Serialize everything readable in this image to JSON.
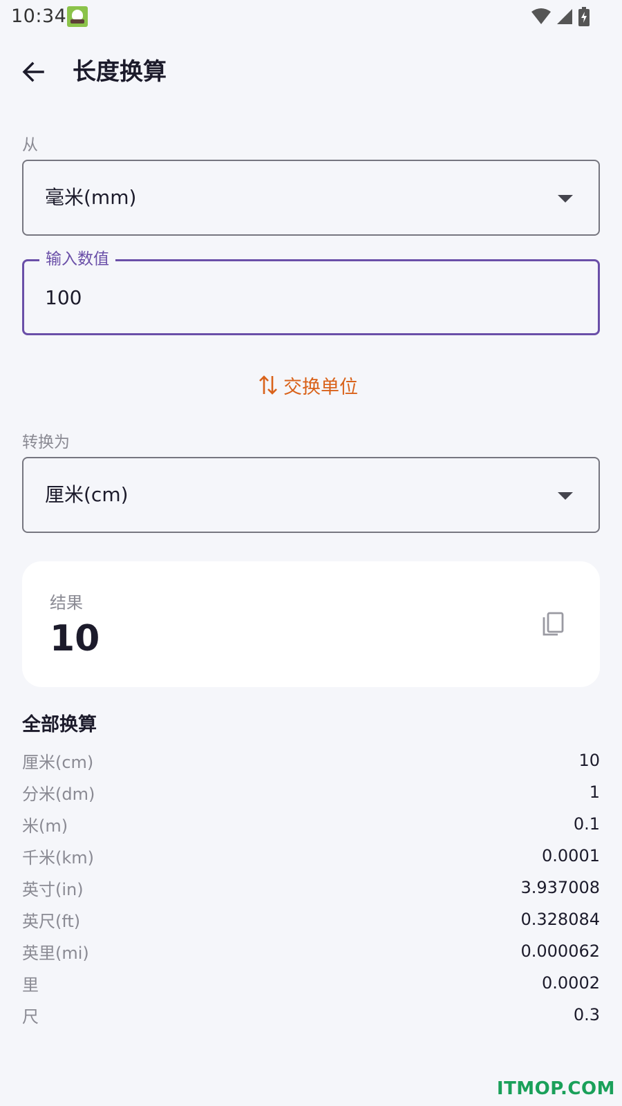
{
  "status_bar": {
    "time": "10:34"
  },
  "header": {
    "title": "长度换算"
  },
  "from": {
    "label": "从",
    "selected": "毫米(mm)"
  },
  "input": {
    "label": "输入数值",
    "value": "100"
  },
  "swap": {
    "label": "交换单位"
  },
  "to": {
    "label": "转换为",
    "selected": "厘米(cm)"
  },
  "result": {
    "label": "结果",
    "value": "10"
  },
  "all_conversions": {
    "title": "全部换算",
    "rows": [
      {
        "unit": "厘米(cm)",
        "value": "10"
      },
      {
        "unit": "分米(dm)",
        "value": "1"
      },
      {
        "unit": "米(m)",
        "value": "0.1"
      },
      {
        "unit": "千米(km)",
        "value": "0.0001"
      },
      {
        "unit": "英寸(in)",
        "value": "3.937008"
      },
      {
        "unit": "英尺(ft)",
        "value": "0.328084"
      },
      {
        "unit": "英里(mi)",
        "value": "0.000062"
      },
      {
        "unit": "里",
        "value": "0.0002"
      },
      {
        "unit": "尺",
        "value": "0.3"
      }
    ]
  },
  "watermark": "ITMOP.COM",
  "colors": {
    "accent": "#6a4fa8",
    "swap": "#d9621a",
    "background": "#f5f6fa"
  }
}
